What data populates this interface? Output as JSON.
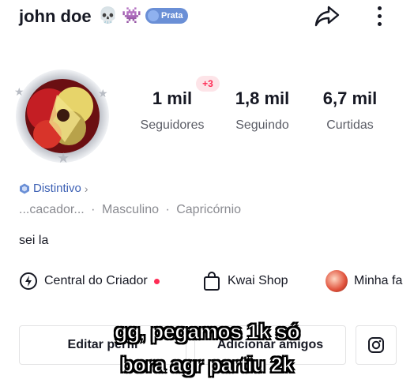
{
  "header": {
    "username": "john doe",
    "emoji_1": "💀",
    "emoji_2": "👾",
    "tier_badge": "Prata",
    "share_icon": "share-arrow-icon",
    "more_icon": "vertical-dots-icon"
  },
  "profile": {
    "new_followers_badge": "+3",
    "stats": [
      {
        "value": "1 mil",
        "label": "Seguidores"
      },
      {
        "value": "1,8 mil",
        "label": "Seguindo"
      },
      {
        "value": "6,7 mil",
        "label": "Curtidas"
      }
    ],
    "distintivo": "Distintivo",
    "meta": [
      "...cacador...",
      "·",
      "Masculino",
      "·",
      "Capricórnio"
    ],
    "bio": "sei la"
  },
  "shortcuts": [
    {
      "label": "Central do Criador",
      "icon": "lightning-circle-icon"
    },
    {
      "label": "Kwai Shop",
      "icon": "shopping-bag-icon"
    },
    {
      "label": "Minha fa",
      "icon": "avatar-icon"
    }
  ],
  "buttons": {
    "edit": "Editar perfil",
    "add": "Adicionar amigos",
    "insta_icon": "instagram-icon"
  },
  "caption": {
    "line1": "gg, pegamos 1k só",
    "line2": "bora agr partiu 2k"
  },
  "colors": {
    "accent": "#fe2c55",
    "tier": "#6a8fd6",
    "badge_text": "#3b5fb3"
  }
}
